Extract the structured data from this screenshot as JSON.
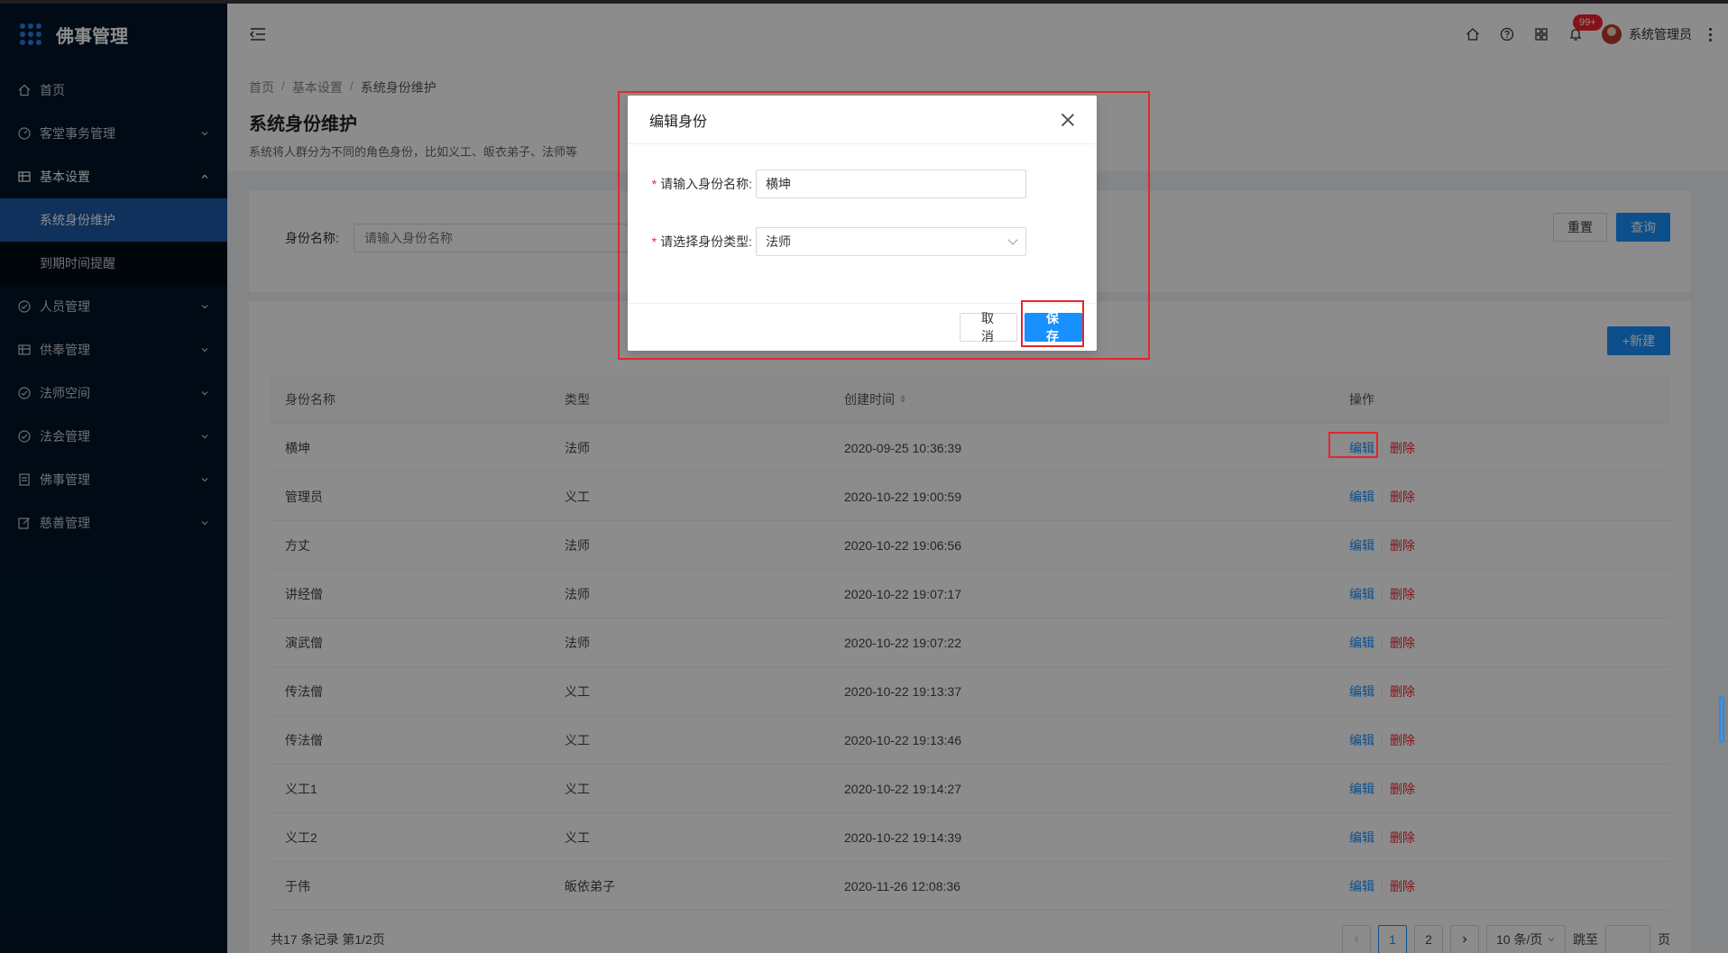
{
  "app": {
    "title": "佛事管理"
  },
  "sidebar": {
    "items": [
      {
        "label": "首页",
        "icon": "home-icon"
      },
      {
        "label": "客堂事务管理",
        "icon": "dashboard-icon"
      },
      {
        "label": "基本设置",
        "icon": "table-icon"
      },
      {
        "label": "人员管理",
        "icon": "check-circle-icon"
      },
      {
        "label": "供奉管理",
        "icon": "table-icon"
      },
      {
        "label": "法师空间",
        "icon": "check-circle-icon"
      },
      {
        "label": "法会管理",
        "icon": "check-circle-icon"
      },
      {
        "label": "佛事管理",
        "icon": "profile-icon"
      },
      {
        "label": "慈善管理",
        "icon": "form-icon"
      }
    ],
    "sub_items": [
      {
        "label": "系统身份维护"
      },
      {
        "label": "到期时间提醒"
      }
    ]
  },
  "header": {
    "badge": "99+",
    "user_name": "系统管理员"
  },
  "page": {
    "breadcrumb": [
      "首页",
      "基本设置",
      "系统身份维护"
    ],
    "title": "系统身份维护",
    "description": "系统将人群分为不同的角色身份，比如义工、皈衣弟子、法师等"
  },
  "search": {
    "label": "身份名称:",
    "placeholder": "请输入身份名称",
    "reset_label": "重置",
    "query_label": "查询"
  },
  "table": {
    "new_label": "+新建",
    "headers": [
      "身份名称",
      "类型",
      "创建时间",
      "操作"
    ],
    "edit_label": "编辑",
    "delete_label": "删除",
    "rows": [
      {
        "name": "横坤",
        "type": "法师",
        "created": "2020-09-25 10:36:39"
      },
      {
        "name": "管理员",
        "type": "义工",
        "created": "2020-10-22 19:00:59"
      },
      {
        "name": "方丈",
        "type": "法师",
        "created": "2020-10-22 19:06:56"
      },
      {
        "name": "讲经僧",
        "type": "法师",
        "created": "2020-10-22 19:07:17"
      },
      {
        "name": "演武僧",
        "type": "法师",
        "created": "2020-10-22 19:07:22"
      },
      {
        "name": "传法僧",
        "type": "义工",
        "created": "2020-10-22 19:13:37"
      },
      {
        "name": "传法僧",
        "type": "义工",
        "created": "2020-10-22 19:13:46"
      },
      {
        "name": "义工1",
        "type": "义工",
        "created": "2020-10-22 19:14:27"
      },
      {
        "name": "义工2",
        "type": "义工",
        "created": "2020-10-22 19:14:39"
      },
      {
        "name": "于伟",
        "type": "皈依弟子",
        "created": "2020-11-26 12:08:36"
      }
    ],
    "total_text": "共17 条记录 第1/2页",
    "pages": [
      "1",
      "2"
    ],
    "page_size": "10 条/页",
    "jump_label": "跳至",
    "page_suffix": "页"
  },
  "modal": {
    "title": "编辑身份",
    "name_label": "请输入身份名称:",
    "name_value": "横坤",
    "type_label": "请选择身份类型:",
    "type_value": "法师",
    "cancel_label": "取 消",
    "save_label": "保 存"
  },
  "colors": {
    "primary": "#1890ff",
    "danger": "#f5222d",
    "sidebar_bg": "#001529",
    "sidebar_active": "#1e5aa8",
    "highlight": "#e3262f"
  }
}
